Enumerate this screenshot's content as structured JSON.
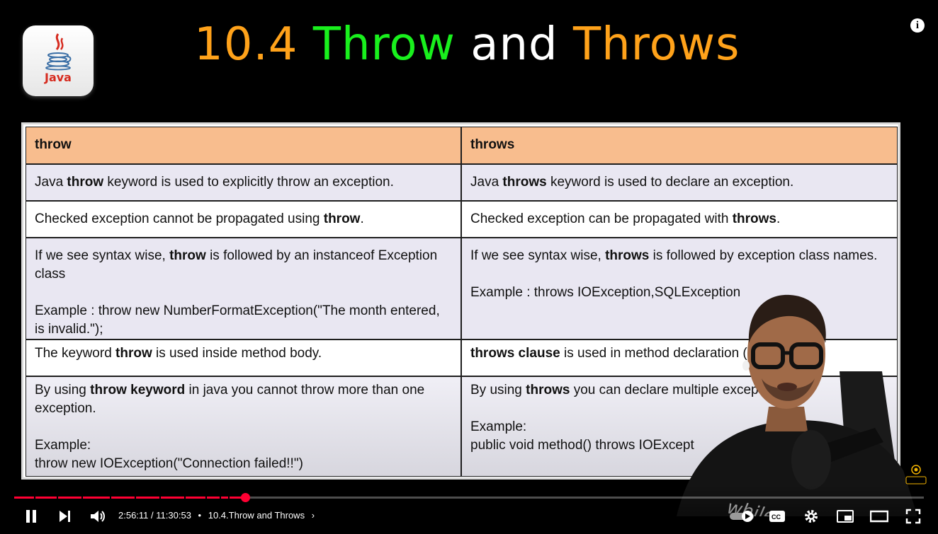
{
  "slide": {
    "logo_text": "Java",
    "title": {
      "num": "10.4",
      "throw": "Throw",
      "and": "and",
      "throws": "Throws"
    },
    "table": {
      "header": {
        "left": "throw",
        "right": "throws"
      },
      "rows": [
        {
          "left": {
            "pre": "Java ",
            "bold": "throw",
            "post": " keyword is used to explicitly throw an exception."
          },
          "right": {
            "pre": "Java ",
            "bold": "throws",
            "post": " keyword is used to declare an exception."
          }
        },
        {
          "left": {
            "pre": "Checked exception cannot be propagated using ",
            "bold": "throw",
            "post": "."
          },
          "right": {
            "pre": "Checked exception can be propagated with ",
            "bold": "throws",
            "post": "."
          }
        },
        {
          "left": {
            "pre": "If we see syntax wise, ",
            "bold": "throw",
            "post": " is followed by an instanceof Exception class",
            "example": "Example : throw new NumberFormatException(\"The month entered, is invalid.\");"
          },
          "right": {
            "pre": "If we see syntax wise, ",
            "bold": "throws",
            "post": " is followed by exception class names.",
            "example": "Example : throws IOException,SQLException"
          }
        },
        {
          "left": {
            "pre": "The keyword ",
            "bold": "throw",
            "post": " is used inside method body."
          },
          "right": {
            "pre": "",
            "bold": "throws clause",
            "post": " is used in method declaration (sig"
          }
        },
        {
          "left": {
            "pre": "By using ",
            "bold": "throw keyword",
            "post": " in java you cannot throw more than one exception.",
            "example_label": "Example:",
            "example_code": "throw new IOException(\"Connection failed!!\")"
          },
          "right": {
            "pre": "By using ",
            "bold": "throws",
            "post": " you can declare multiple excepti",
            "example_label": "Example:",
            "example_code": "public void method() throws IOExcept"
          }
        }
      ]
    }
  },
  "player": {
    "time_current": "2:56:11",
    "time_total": "11:30:53",
    "separator": "•",
    "chapter_title": "10.4.Throw and Throws",
    "progress_fraction": 0.254,
    "accent_color": "#ff0033",
    "icons": [
      "pause-icon",
      "next-icon",
      "volume-icon",
      "chevron-right-icon",
      "autoplay-toggle",
      "captions-icon",
      "settings-icon",
      "miniplayer-icon",
      "theater-icon",
      "fullscreen-icon",
      "info-icon"
    ]
  }
}
